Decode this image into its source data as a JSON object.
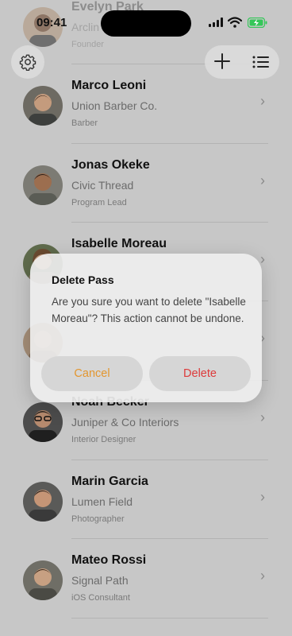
{
  "status_bar": {
    "time": "09:41"
  },
  "contacts": [
    {
      "name": "Evelyn Park",
      "company": "Arclin",
      "role": "Founder"
    },
    {
      "name": "Marco Leoni",
      "company": "Union Barber Co.",
      "role": "Barber"
    },
    {
      "name": "Jonas Okeke",
      "company": "Civic Thread",
      "role": "Program Lead"
    },
    {
      "name": "Isabelle Moreau",
      "company": "",
      "role": ""
    },
    {
      "name": "",
      "company": "",
      "role": ""
    },
    {
      "name": "Noah Becker",
      "company": "Juniper & Co Interiors",
      "role": "Interior Designer"
    },
    {
      "name": "Marin Garcia",
      "company": "Lumen Field",
      "role": "Photographer"
    },
    {
      "name": "Mateo Rossi",
      "company": "Signal Path",
      "role": "iOS Consultant"
    }
  ],
  "toolbar": {
    "settings_icon": "gear-icon",
    "add_icon": "plus-icon",
    "menu_icon": "list-icon"
  },
  "dialog": {
    "title": "Delete Pass",
    "message": "Are you sure you want to delete \"Isabelle Moreau\"? This action cannot be undone.",
    "cancel_label": "Cancel",
    "delete_label": "Delete"
  },
  "colors": {
    "cancel": "#e3962f",
    "delete": "#dd3b3b",
    "background": "#c7c7c7"
  }
}
